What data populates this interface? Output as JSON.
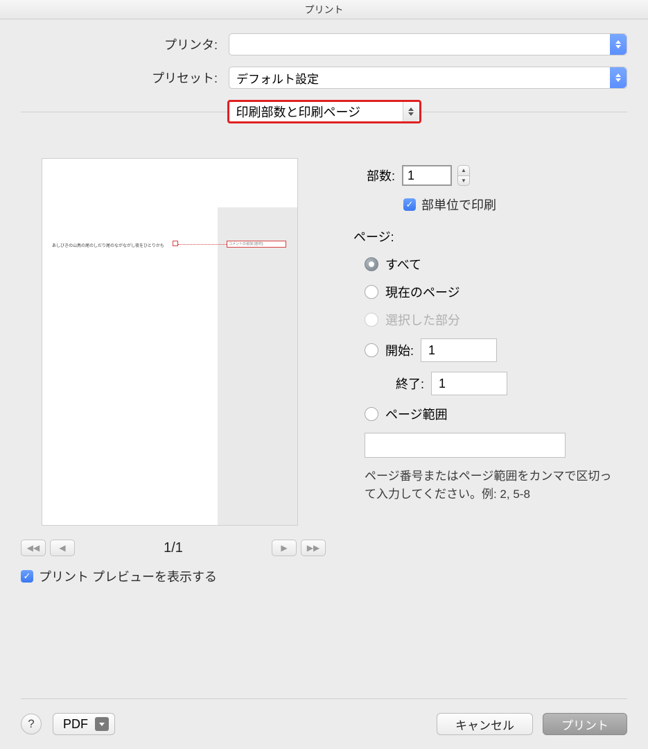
{
  "title": "プリント",
  "printer": {
    "label": "プリンタ:",
    "value": ""
  },
  "preset": {
    "label": "プリセット:",
    "value": "デフォルト設定"
  },
  "section": {
    "value": "印刷部数と印刷ページ"
  },
  "copies": {
    "label": "部数:",
    "value": "1",
    "collate": "部単位で印刷"
  },
  "pages": {
    "label": "ページ:",
    "all": "すべて",
    "current": "現在のページ",
    "selection": "選択した部分",
    "from_label": "開始:",
    "from_value": "1",
    "to_label": "終了:",
    "to_value": "1",
    "range_label": "ページ範囲",
    "range_value": "",
    "hint": "ページ番号またはページ範囲をカンマで区切って入力してください。例: 2, 5-8"
  },
  "preview": {
    "indicator": "1/1",
    "show_label": "プリント プレビューを表示する",
    "doc_line": "あしびきの山鳥の尾のしだり尾のながながし夜をひとりかも",
    "comment_label": "コメントの追加 [岩村]:"
  },
  "footer": {
    "pdf": "PDF",
    "cancel": "キャンセル",
    "print": "プリント",
    "help": "?"
  }
}
